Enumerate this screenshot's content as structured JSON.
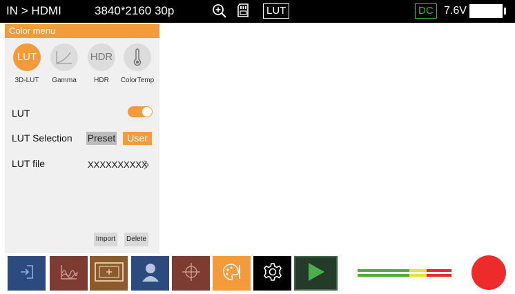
{
  "status_bar": {
    "input": "IN > HDMI",
    "resolution": "3840*2160 30p",
    "lut_badge": "LUT",
    "power_source": "DC",
    "voltage": "7.6V",
    "icons": [
      "zoom-in-icon",
      "sd-card-icon",
      "battery-icon"
    ]
  },
  "panel": {
    "title": "Color menu",
    "modes": [
      {
        "glyph": "LUT",
        "label": "3D-LUT",
        "active": true
      },
      {
        "glyph": "",
        "label": "Gamma",
        "active": false
      },
      {
        "glyph": "HDR",
        "label": "HDR",
        "active": false
      },
      {
        "glyph": "",
        "label": "ColorTemp",
        "active": false
      }
    ],
    "lut_label": "LUT",
    "lut_enabled": true,
    "selection_label": "LUT Selection",
    "selection_options": [
      "Preset",
      "User"
    ],
    "selected_option": "User",
    "file_label": "LUT file",
    "file_value": "XXXXXXXXXX",
    "import_label": "Import",
    "delete_label": "Delete"
  },
  "toolbar": {
    "buttons": [
      {
        "name": "input-icon",
        "color": "#2b4a7e"
      },
      {
        "name": "waveform-icon",
        "color": "#7e3b32"
      },
      {
        "name": "frame-marker-icon",
        "color": "#8c5a2b"
      },
      {
        "name": "portrait-icon",
        "color": "#2b4a7e"
      },
      {
        "name": "crosshair-icon",
        "color": "#7e3b32"
      },
      {
        "name": "color-palette-icon",
        "color": "#f39a3a"
      },
      {
        "name": "settings-gear-icon",
        "color": "#000000"
      },
      {
        "name": "play-icon",
        "color": "#243b2a"
      }
    ]
  },
  "colors": {
    "accent": "#f39a3a",
    "record": "#ee2b2b",
    "dc_green": "#2fbf2f"
  }
}
